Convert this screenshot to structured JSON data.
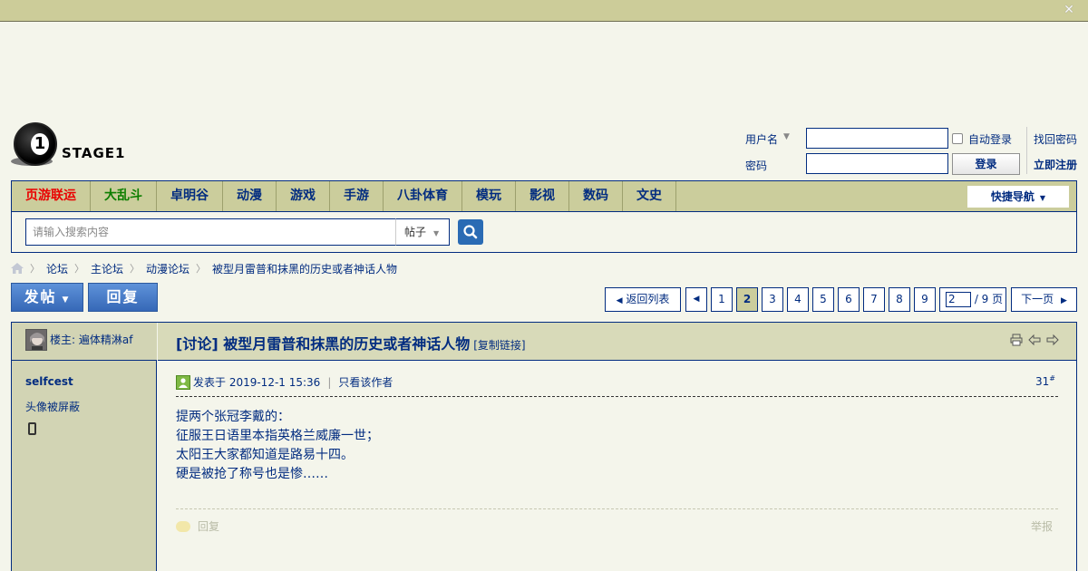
{
  "topbar": {
    "close_icon": "close-icon"
  },
  "logo": {
    "numeral": "1",
    "text": "STAGE1"
  },
  "login": {
    "username_label": "用户名",
    "password_label": "密码",
    "auto_login": "自动登录",
    "login_button": "登录",
    "forgot": "找回密码",
    "register": "立即注册"
  },
  "nav": {
    "items": [
      {
        "label": "页游联运",
        "color": "#ea0000"
      },
      {
        "label": "大乱斗",
        "color": "#0c7e00"
      },
      {
        "label": "卓明谷"
      },
      {
        "label": "动漫"
      },
      {
        "label": "游戏"
      },
      {
        "label": "手游"
      },
      {
        "label": "八卦体育"
      },
      {
        "label": "模玩"
      },
      {
        "label": "影视"
      },
      {
        "label": "数码"
      },
      {
        "label": "文史"
      }
    ],
    "quick": "快捷导航"
  },
  "search": {
    "placeholder": "请输入搜索内容",
    "type": "帖子"
  },
  "breadcrumb": [
    "论坛",
    "主论坛",
    "动漫论坛",
    "被型月雷普和抹黑的历史或者神话人物"
  ],
  "actions": {
    "post": "发帖",
    "reply": "回复"
  },
  "pager": {
    "back": "返回列表",
    "pages": [
      "1",
      "2",
      "3",
      "4",
      "5",
      "6",
      "7",
      "8",
      "9"
    ],
    "current": "2",
    "input_value": "2",
    "total": "/ 9 页",
    "next": "下一页"
  },
  "thread": {
    "owner": "楼主: 遍体精淋af",
    "title": "[讨论] 被型月雷普和抹黑的历史或者神话人物",
    "copy_link": "[复制链接]"
  },
  "post": {
    "author": "selfcest",
    "avatar_blocked": "头像被屏蔽",
    "posted": "发表于 2019-12-1 15:36",
    "only_author": "只看该作者",
    "floor": "31",
    "floor_mark": "#",
    "content": "提两个张冠李戴的：\n征服王日语里本指英格兰威廉一世；\n太阳王大家都知道是路易十四。\n硬是被抢了称号也是惨……",
    "reply": "回复",
    "report": "举报"
  }
}
